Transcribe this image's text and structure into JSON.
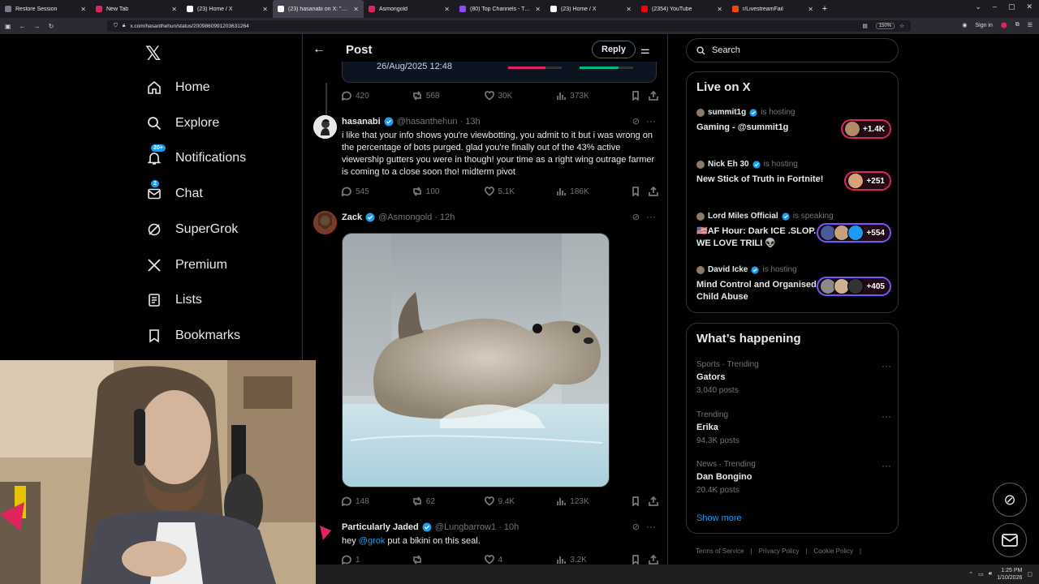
{
  "browser": {
    "tabs": [
      {
        "label": "Restore Session",
        "color": "#7a7a8c"
      },
      {
        "label": "New Tab",
        "color": "#e0245e"
      },
      {
        "label": "(23) Home / X",
        "color": "#ffffff"
      },
      {
        "label": "(23) hasanabi on X: \"when twit",
        "color": "#ffffff"
      },
      {
        "label": "Asmongold",
        "color": "#e0245e"
      },
      {
        "label": "(80) Top Channels - Twitch",
        "color": "#9146ff"
      },
      {
        "label": "(23) Home / X",
        "color": "#ffffff"
      },
      {
        "label": "(2354) YouTube",
        "color": "#ff0000"
      },
      {
        "label": "r/LivestreamFail",
        "color": "#ff4500"
      }
    ],
    "active_tab": 3,
    "url": "x.com/hasanthehun/status/2009860991203631264",
    "zoom": "150%",
    "sign_in": "Sign in"
  },
  "nav": {
    "items": [
      {
        "label": "Home",
        "icon": "home-icon"
      },
      {
        "label": "Explore",
        "icon": "search-icon"
      },
      {
        "label": "Notifications",
        "icon": "bell-icon",
        "badge": "20+"
      },
      {
        "label": "Chat",
        "icon": "mail-icon",
        "badge": "2"
      },
      {
        "label": "SuperGrok",
        "icon": "grok-icon"
      },
      {
        "label": "Premium",
        "icon": "x-icon"
      },
      {
        "label": "Lists",
        "icon": "list-icon"
      },
      {
        "label": "Bookmarks",
        "icon": "bookmark-icon"
      }
    ]
  },
  "post": {
    "title": "Post",
    "reply_label": "Reply",
    "embed_date": "26/Aug/2025 12:48",
    "parent_stats": {
      "replies": "420",
      "reposts": "568",
      "likes": "30K",
      "views": "373K"
    },
    "tweets": [
      {
        "name": "hasanabi",
        "handle": "@hasanthehun · 13h",
        "text": "i like that your info shows you're viewbotting, you admit to it but i was wrong on the percentage of bots purged. glad you're finally out of the 43% active viewership gutters you were in though! your time as a right wing outrage farmer is coming to a close soon tho! midterm pivot",
        "stats": {
          "replies": "545",
          "reposts": "100",
          "likes": "5.1K",
          "views": "186K"
        }
      },
      {
        "name": "Zack",
        "handle": "@Asmongold · 12h",
        "text": "",
        "stats": {
          "replies": "148",
          "reposts": "62",
          "likes": "9.4K",
          "views": "123K"
        }
      },
      {
        "name": "Particularly Jaded",
        "handle": "@Lungbarrow1 · 10h",
        "text_prefix": "hey ",
        "mention": "@grok",
        "text_suffix": " put a bikini on this seal.",
        "stats": {
          "replies": "1",
          "reposts": "",
          "likes": "4",
          "views": "3.2K"
        }
      }
    ]
  },
  "sidebar": {
    "search_placeholder": "Search",
    "live_title": "Live on X",
    "live": [
      {
        "host": "summit1g",
        "status": "is hosting",
        "title": "Gaming - @summit1g",
        "count": "+1.4K",
        "pill": "#e0245e"
      },
      {
        "host": "Nick Eh 30",
        "status": "is hosting",
        "title": "New Stick of Truth in Fortnite!",
        "count": "+251",
        "pill": "#e0245e"
      },
      {
        "host": "Lord Miles Official",
        "status": "is speaking",
        "title": "🇺🇸AF Hour: Dark ICE .SLOP. WE LOVE TRILI 👽",
        "count": "+554",
        "pill": "#7856ff"
      },
      {
        "host": "David Icke",
        "status": "is hosting",
        "title": "Mind Control and Organised Child Abuse",
        "count": "+405",
        "pill": "#7856ff"
      }
    ],
    "happening_title": "What’s happening",
    "trends": [
      {
        "category": "Sports · Trending",
        "name": "Gators",
        "count": "3,040 posts"
      },
      {
        "category": "Trending",
        "name": "Erika",
        "count": "94.3K posts"
      },
      {
        "category": "News · Trending",
        "name": "Dan Bongino",
        "count": "20.4K posts"
      }
    ],
    "show_more": "Show more",
    "footer": [
      "Terms of Service",
      "|",
      "Privacy Policy",
      "|",
      "Cookie Policy",
      "|"
    ]
  },
  "taskbar": {
    "time": "1:25 PM",
    "date": "1/10/2026"
  }
}
